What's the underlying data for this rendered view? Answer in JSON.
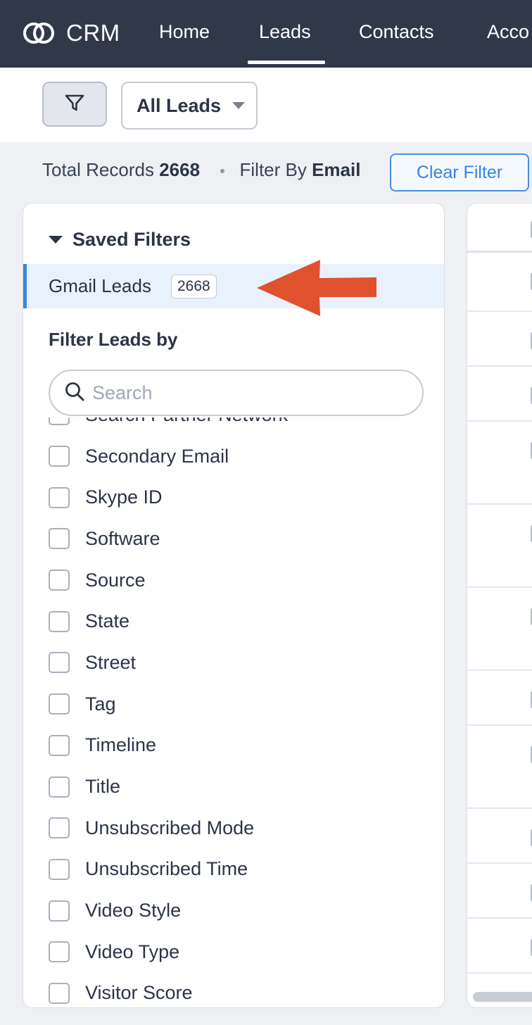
{
  "nav": {
    "logo_text": "CRM",
    "items": [
      "Home",
      "Leads",
      "Contacts",
      "Acco"
    ],
    "active": "Leads"
  },
  "toolbar": {
    "filter_icon": "funnel-icon",
    "view_label": "All Leads"
  },
  "records": {
    "total_label": "Total Records",
    "total_value": "2668",
    "filter_label": "Filter By",
    "filter_value": "Email",
    "clear_label": "Clear Filter"
  },
  "saved_filters": {
    "header": "Saved Filters",
    "items": [
      {
        "label": "Gmail Leads",
        "count": "2668"
      }
    ]
  },
  "filter_leads": {
    "header": "Filter Leads by",
    "search_placeholder": "Search",
    "fields": [
      "Search Partner Network",
      "Secondary Email",
      "Skype ID",
      "Software",
      "Source",
      "State",
      "Street",
      "Tag",
      "Timeline",
      "Title",
      "Unsubscribed Mode",
      "Unsubscribed Time",
      "Video Style",
      "Video Type",
      "Visitor Score"
    ]
  },
  "colors": {
    "nav_bg": "#313949",
    "accent": "#3a84dc",
    "annotation_arrow": "#e0512e"
  }
}
